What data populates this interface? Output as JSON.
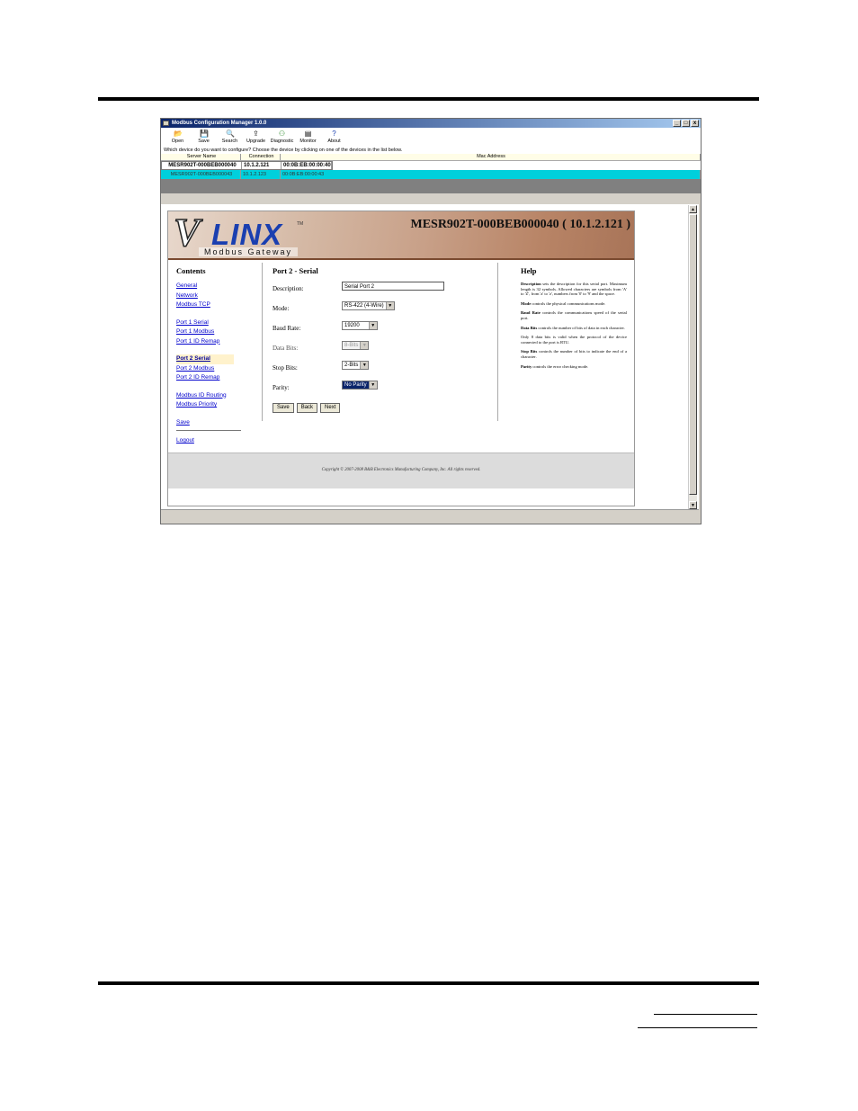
{
  "window": {
    "title": "Modbus Configuration Manager 1.0.0",
    "controls": [
      "_",
      "□",
      "x"
    ]
  },
  "toolbar": [
    {
      "label": "Open",
      "icon": "folder-icon",
      "glyph": "📂"
    },
    {
      "label": "Save",
      "icon": "floppy-icon",
      "glyph": "💾"
    },
    {
      "label": "Search",
      "icon": "magnifier-icon",
      "glyph": "🔍"
    },
    {
      "label": "Upgrade",
      "icon": "upgrade-icon",
      "glyph": "⇪"
    },
    {
      "label": "Diagnostic",
      "icon": "diagnostic-icon",
      "glyph": "⚇"
    },
    {
      "label": "Monitor",
      "icon": "monitor-icon",
      "glyph": "▤"
    },
    {
      "label": "About",
      "icon": "question-icon",
      "glyph": "?"
    }
  ],
  "prompt": "Which device do you want to configure? Choose the device by clicking on one of the devices in the list below.",
  "device_table": {
    "headers": [
      "Server Name",
      "Connection",
      "Mac Address"
    ],
    "rows": [
      {
        "name": "MESR902T-000BEB000040",
        "ip": "10.1.2.121",
        "mac": "00:0B:EB:00:00:40",
        "selected": true
      },
      {
        "name": "MESR902T-000BEB000043",
        "ip": "10.1.2.123",
        "mac": "00:0B:EB:00:00:43",
        "selected": false
      }
    ]
  },
  "banner": {
    "logo_v": "V",
    "logo_linx": "LINX",
    "logo_tm": "TM",
    "logo_sub": "Modbus Gateway",
    "title": "MESR902T-000BEB000040 ( 10.1.2.121 )"
  },
  "contents": {
    "heading": "Contents",
    "groups": [
      [
        "General",
        "Network",
        "Modbus TCP"
      ],
      [
        "Port 1 Serial",
        "Port 1 Modbus",
        "Port 1 ID Remap"
      ],
      [
        "Port 2 Serial",
        "Port 2 Modbus",
        "Port 2 ID Remap"
      ],
      [
        "Modbus ID Routing",
        "Modbus Priority"
      ]
    ],
    "active": "Port 2 Serial",
    "save": "Save",
    "logout": "Logout"
  },
  "form": {
    "heading": "Port 2 - Serial",
    "description_label": "Description:",
    "description_value": "Serial Port 2",
    "mode_label": "Mode:",
    "mode_value": "RS-422 (4-Wire)",
    "baud_label": "Baud Rate:",
    "baud_value": "19200",
    "databits_label": "Data Bits:",
    "databits_value": "8-Bits",
    "stopbits_label": "Stop Bits:",
    "stopbits_value": "2-Bits",
    "parity_label": "Parity:",
    "parity_value": "No Parity",
    "save_button": "Save",
    "back_button": "Back",
    "next_button": "Next"
  },
  "help": {
    "heading": "Help",
    "items": [
      {
        "term": "Description",
        "text": " sets the description for this serial port. Maximum length is 32 symbols. Allowed characters are symbols from 'A' to 'Z', from 'a' to 'z', numbers from '0' to '9' and the space."
      },
      {
        "term": "Mode",
        "text": " controls the physical communications mode."
      },
      {
        "term": "Baud Rate",
        "text": " controls the communications speed of the serial port."
      },
      {
        "term": "Data Bits",
        "text": " controls the number of bits of data in each character."
      },
      {
        "term": "",
        "text": "Only 8 data bits is valid when the protocol of the device connected to the port is RTU."
      },
      {
        "term": "Stop Bits",
        "text": " controls the number of bits to indicate the end of a character."
      },
      {
        "term": "Parity",
        "text": " controls the error checking mode."
      }
    ]
  },
  "footer": {
    "copyright": "Copyright © 2007-2008 B&B Electronics Manufacturing Company, Inc. All rights reserved."
  },
  "scroll": {
    "up": "▲",
    "down": "▼"
  },
  "select_arrow": "▼"
}
